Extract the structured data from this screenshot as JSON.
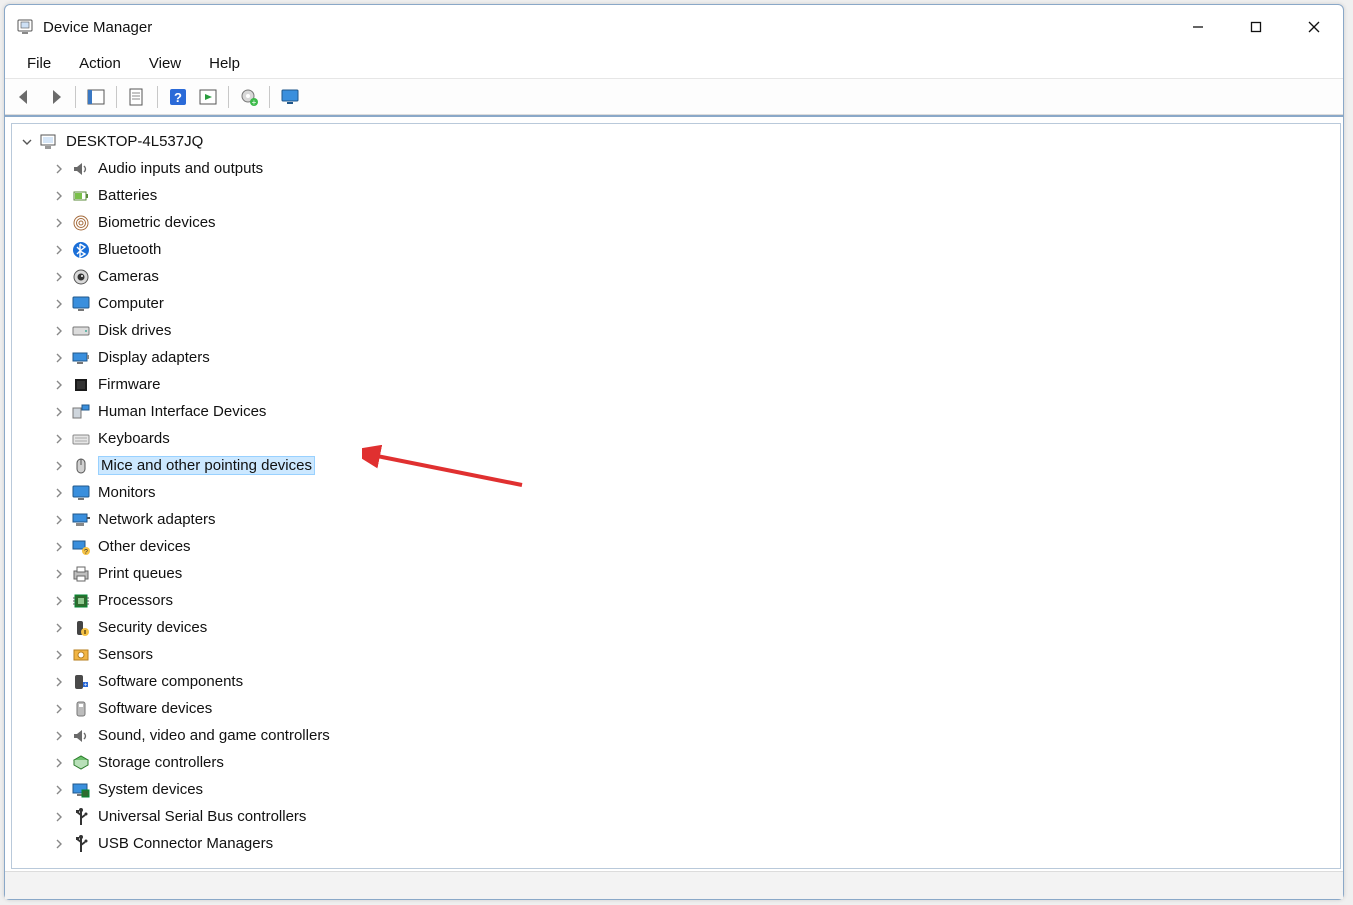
{
  "window": {
    "title": "Device Manager"
  },
  "menubar": [
    "File",
    "Action",
    "View",
    "Help"
  ],
  "toolbar": [
    {
      "name": "nav-back",
      "icon": "arrow-left"
    },
    {
      "name": "nav-forward",
      "icon": "arrow-right"
    },
    {
      "sep": true
    },
    {
      "name": "show-hidden",
      "icon": "panel"
    },
    {
      "sep": true
    },
    {
      "name": "properties",
      "icon": "sheet"
    },
    {
      "sep": true
    },
    {
      "name": "help",
      "icon": "help"
    },
    {
      "name": "update-driver",
      "icon": "play-panel"
    },
    {
      "sep": true
    },
    {
      "name": "uninstall-device",
      "icon": "gear-green"
    },
    {
      "sep": true
    },
    {
      "name": "scan-hardware",
      "icon": "monitor-blue"
    }
  ],
  "tree": {
    "root": {
      "label": "DESKTOP-4L537JQ",
      "icon": "computer-root",
      "expanded": true
    },
    "categories": [
      {
        "label": "Audio inputs and outputs",
        "icon": "speaker"
      },
      {
        "label": "Batteries",
        "icon": "battery"
      },
      {
        "label": "Biometric devices",
        "icon": "fingerprint"
      },
      {
        "label": "Bluetooth",
        "icon": "bluetooth"
      },
      {
        "label": "Cameras",
        "icon": "camera"
      },
      {
        "label": "Computer",
        "icon": "monitor"
      },
      {
        "label": "Disk drives",
        "icon": "disk"
      },
      {
        "label": "Display adapters",
        "icon": "display-adapter"
      },
      {
        "label": "Firmware",
        "icon": "chip-black"
      },
      {
        "label": "Human Interface Devices",
        "icon": "hid"
      },
      {
        "label": "Keyboards",
        "icon": "keyboard"
      },
      {
        "label": "Mice and other pointing devices",
        "icon": "mouse",
        "selected": true
      },
      {
        "label": "Monitors",
        "icon": "monitor"
      },
      {
        "label": "Network adapters",
        "icon": "network"
      },
      {
        "label": "Other devices",
        "icon": "other"
      },
      {
        "label": "Print queues",
        "icon": "printer"
      },
      {
        "label": "Processors",
        "icon": "cpu"
      },
      {
        "label": "Security devices",
        "icon": "security"
      },
      {
        "label": "Sensors",
        "icon": "sensor"
      },
      {
        "label": "Software components",
        "icon": "sw-comp"
      },
      {
        "label": "Software devices",
        "icon": "sw-dev"
      },
      {
        "label": "Sound, video and game controllers",
        "icon": "speaker"
      },
      {
        "label": "Storage controllers",
        "icon": "storage"
      },
      {
        "label": "System devices",
        "icon": "system"
      },
      {
        "label": "Universal Serial Bus controllers",
        "icon": "usb"
      },
      {
        "label": "USB Connector Managers",
        "icon": "usb"
      }
    ]
  },
  "annotation": {
    "arrow": {
      "target_index": 11,
      "color": "#e03030"
    }
  }
}
